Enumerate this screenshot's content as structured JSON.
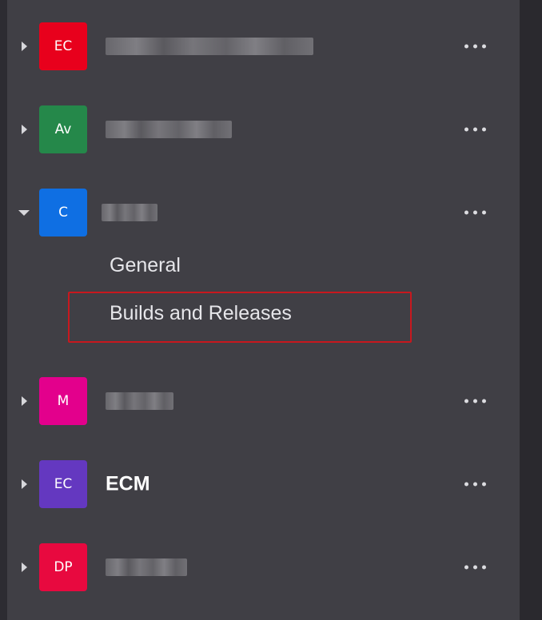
{
  "teams": [
    {
      "initials": "EC",
      "color": "#e8001c",
      "name": "",
      "expanded": false
    },
    {
      "initials": "Av",
      "color": "#25884a",
      "name": "",
      "expanded": false
    },
    {
      "initials": "C",
      "color": "#0f6fe3",
      "name": "",
      "expanded": true
    },
    {
      "initials": "M",
      "color": "#e3008c",
      "name": "",
      "expanded": false
    },
    {
      "initials": "EC",
      "color": "#6438c0",
      "name": "ECM",
      "expanded": false
    },
    {
      "initials": "DP",
      "color": "#e8093f",
      "name": "",
      "expanded": false
    }
  ],
  "channels": [
    {
      "label": "General"
    },
    {
      "label": "Builds and Releases"
    }
  ],
  "icons": {
    "collapsed": "caret-right-icon",
    "expanded": "caret-down-icon",
    "more": "more-options-icon"
  }
}
